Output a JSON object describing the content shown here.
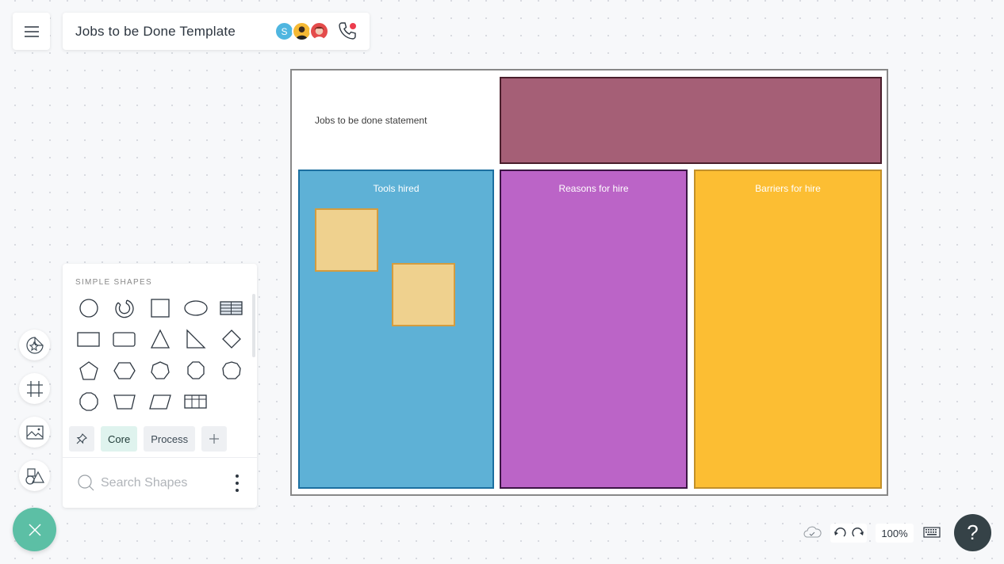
{
  "header": {
    "menu_icon": "hamburger-menu-icon",
    "title": "Jobs to be Done Template",
    "collaborators": [
      {
        "initial": "S",
        "color": "#4fb6e0"
      },
      {
        "initial": "",
        "color": "#f5b935"
      },
      {
        "initial": "",
        "color": "#e44b4b"
      }
    ],
    "call_icon": "phone-icon",
    "call_indicator_color": "#ec3c4d"
  },
  "board": {
    "statement_label": "Jobs to be done statement",
    "statement_box_color": "#a55f76",
    "columns": [
      {
        "label": "Tools hired",
        "color": "#5eb1d6"
      },
      {
        "label": "Reasons for hire",
        "color": "#bb64c7"
      },
      {
        "label": "Barriers for hire",
        "color": "#fcbe33"
      }
    ],
    "sticky_notes": [
      {
        "color": "#efd18e",
        "text": ""
      },
      {
        "color": "#efd18e",
        "text": ""
      }
    ]
  },
  "shapes_panel": {
    "heading": "SIMPLE SHAPES",
    "shapes": [
      "circle",
      "ring",
      "square",
      "ellipse",
      "table-striped",
      "rectangle",
      "rounded-rectangle",
      "triangle",
      "right-triangle",
      "diamond",
      "pentagon",
      "hexagon",
      "heptagon",
      "octagon",
      "nonagon",
      "decagon",
      "trapezoid",
      "parallelogram",
      "grid-table"
    ],
    "tabs": [
      {
        "label": "",
        "icon": "pin-icon"
      },
      {
        "label": "Core",
        "active": true
      },
      {
        "label": "Process"
      },
      {
        "label": "",
        "icon": "plus-icon"
      }
    ],
    "search": {
      "placeholder": "Search Shapes",
      "value": ""
    }
  },
  "left_toolbar": {
    "items": [
      "sticker-icon",
      "frame-icon",
      "image-icon",
      "shapes-icon"
    ],
    "fab_icon": "close-icon",
    "fab_color": "#5cbfa5"
  },
  "bottom_bar": {
    "sync_icon": "cloud-saved-icon",
    "zoom_level": "100%",
    "help_label": "?"
  }
}
